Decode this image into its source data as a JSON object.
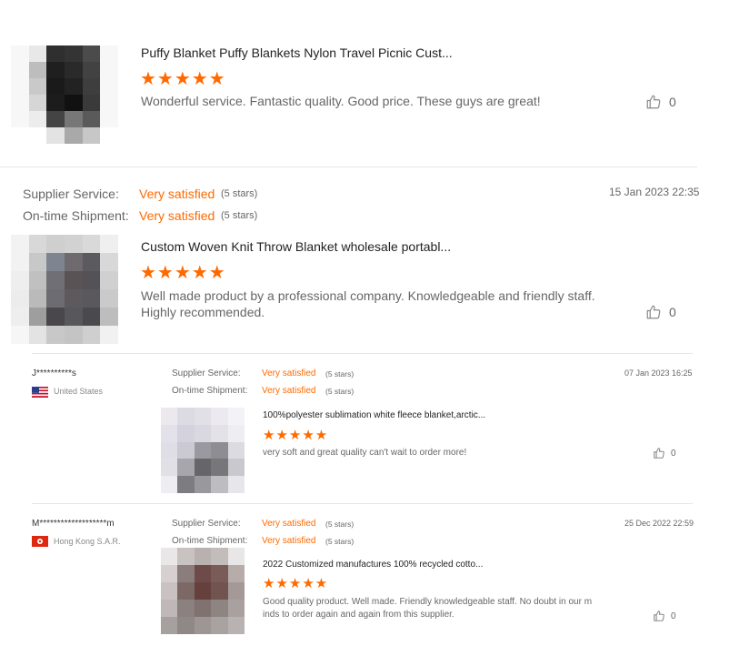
{
  "reviews": [
    {
      "product_title": "Puffy Blanket Puffy Blankets Nylon Travel Picnic Cust...",
      "stars": "★★★★★",
      "comment": "Wonderful service. Fantastic quality. Good price. These guys are great!",
      "likes": "0"
    },
    {
      "supplier_service_label": "Supplier Service:",
      "supplier_service_value": "Very satisfied",
      "supplier_service_stars": "(5 stars)",
      "shipment_label": "On-time Shipment:",
      "shipment_value": "Very satisfied",
      "shipment_stars": "(5 stars)",
      "date": "15 Jan 2023 22:35",
      "product_title": "Custom Woven Knit Throw Blanket wholesale portabl...",
      "stars": "★★★★★",
      "comment_line1": "Well made product by a professional company. Knowledgeable and friendly staff.",
      "comment_line2": "Highly recommended.",
      "likes": "0"
    },
    {
      "reviewer": "J**********s",
      "country": "United States",
      "supplier_service_label": "Supplier Service:",
      "supplier_service_value": "Very satisfied",
      "supplier_service_stars": "(5 stars)",
      "shipment_label": "On-time Shipment:",
      "shipment_value": "Very satisfied",
      "shipment_stars": "(5 stars)",
      "date": "07 Jan 2023 16:25",
      "product_title": "100%polyester sublimation white fleece blanket,arctic...",
      "stars": "★★★★★",
      "comment": "very soft and great quality can't wait to order more!",
      "likes": "0"
    },
    {
      "reviewer": "M*******************m",
      "country": "Hong Kong S.A.R.",
      "supplier_service_label": "Supplier Service:",
      "supplier_service_value": "Very satisfied",
      "supplier_service_stars": "(5 stars)",
      "shipment_label": "On-time Shipment:",
      "shipment_value": "Very satisfied",
      "shipment_stars": "(5 stars)",
      "date": "25 Dec 2022 22:59",
      "product_title": "2022 Customized manufactures 100% recycled cotto...",
      "stars": "★★★★★",
      "comment_line1": "Good quality product. Well made. Friendly knowledgeable staff. No doubt in our m",
      "comment_line2": "inds to order again and again from this supplier.",
      "likes": "0"
    }
  ],
  "colors": {
    "accent": "#ff6a00",
    "divider": "#e6e6e6",
    "muted_text": "#666666"
  },
  "icons": {
    "like": "thumbs-up-icon",
    "flag_us": "us-flag-icon",
    "flag_hk": "hk-flag-icon"
  }
}
